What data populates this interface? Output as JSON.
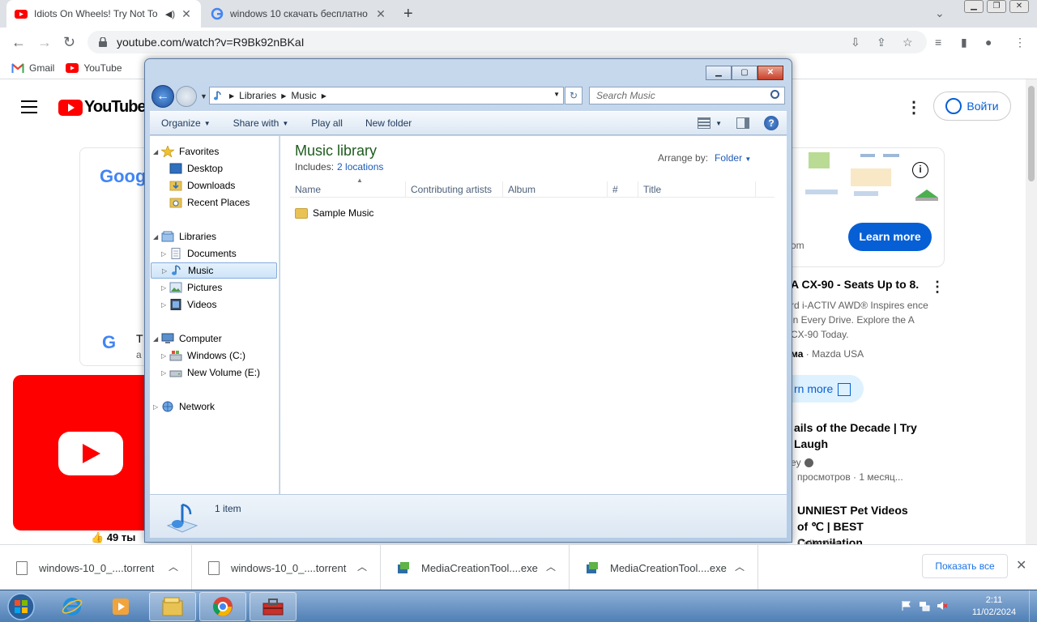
{
  "browser": {
    "tabs": [
      {
        "title": "Idiots On Wheels! Try Not To",
        "active": true
      },
      {
        "title": "windows 10 скачать бесплатно",
        "active": false
      }
    ],
    "new_tab": "+",
    "url": "youtube.com/watch?v=R9Bk92nBKaI",
    "bookmarks": [
      "Gmail",
      "YouTube"
    ]
  },
  "youtube": {
    "logo_text": "YouTube",
    "signin": "Войти",
    "ad_google_text": "Goog",
    "ad_title_fragment": "T",
    "ad_sub_fragment": "a",
    "likes": "49 ты",
    "right_om": "om",
    "learn_more": "Learn more",
    "promo_title": "A CX-90 - Seats Up to 8.",
    "promo_desc": "rd i-ACTIV AWD® Inspires ence in Every Drive. Explore the A CX-90 Today.",
    "promo_adv_prefix": "ма",
    "promo_adv": "· Mazda USA",
    "promo_learn": "rn more",
    "video1_title": "ails of the Decade | Try Laugh",
    "video1_channel": "ey",
    "video1_meta": "просмотров · 1 месяц...",
    "video2_title": "UNNIEST Pet Videos of ℃ | BEST Compilation",
    "video2_channel": "Collective"
  },
  "downloads": {
    "items": [
      {
        "name": "windows-10_0_....torrent",
        "type": "file"
      },
      {
        "name": "windows-10_0_....torrent",
        "type": "file"
      },
      {
        "name": "MediaCreationTool....exe",
        "type": "exe"
      },
      {
        "name": "MediaCreationTool....exe",
        "type": "exe"
      }
    ],
    "show_all": "Показать все"
  },
  "taskbar": {
    "time": "2:11",
    "date": "11/02/2024"
  },
  "explorer": {
    "breadcrumb": [
      "Libraries",
      "Music"
    ],
    "search_placeholder": "Search Music",
    "commands": {
      "organize": "Organize",
      "share_with": "Share with",
      "play_all": "Play all",
      "new_folder": "New folder"
    },
    "nav": {
      "favorites": "Favorites",
      "desktop": "Desktop",
      "downloads": "Downloads",
      "recent_places": "Recent Places",
      "libraries": "Libraries",
      "documents": "Documents",
      "music": "Music",
      "pictures": "Pictures",
      "videos": "Videos",
      "computer": "Computer",
      "windows_c": "Windows (C:)",
      "new_volume_e": "New Volume (E:)",
      "network": "Network"
    },
    "library_title": "Music library",
    "includes_label": "Includes:",
    "includes_link": "2 locations",
    "arrange_by_label": "Arrange by:",
    "arrange_by_value": "Folder",
    "columns": [
      "Name",
      "Contributing artists",
      "Album",
      "#",
      "Title"
    ],
    "rows": [
      {
        "name": "Sample Music"
      }
    ],
    "item_count": "1 item"
  }
}
